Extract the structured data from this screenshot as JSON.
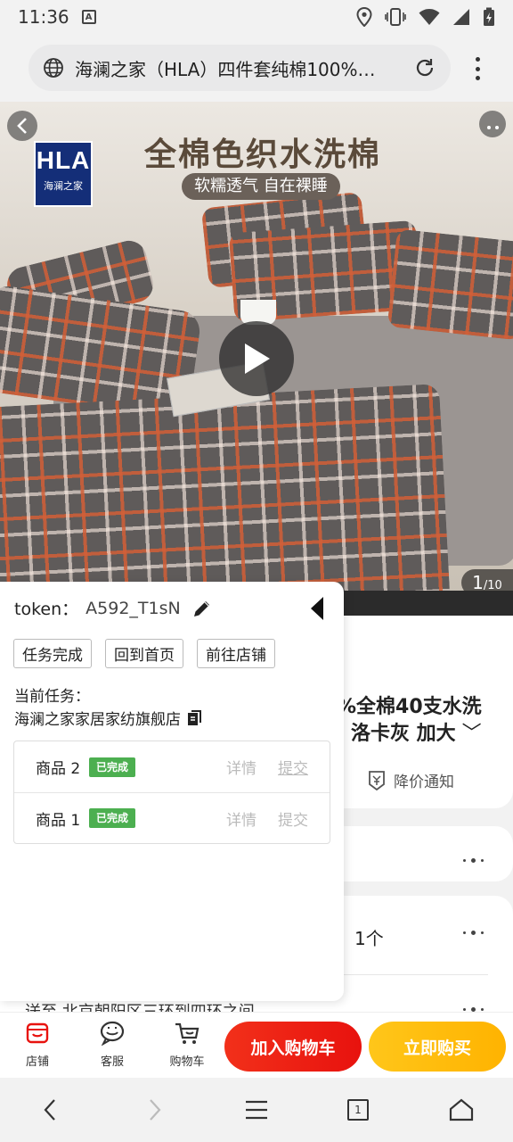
{
  "status_bar": {
    "time": "11:36"
  },
  "browser": {
    "url_text": "海澜之家（HLA）四件套纯棉100%…"
  },
  "hero": {
    "logo_line1": "HLA",
    "logo_line2": "海澜之家",
    "headline": "全棉色织水洗棉",
    "subheadline": "软糯透气 自在裸睡",
    "page_current": "1",
    "page_total": "/10"
  },
  "product": {
    "name_line1": "%全棉40支水洗",
    "name_line2": "洛卡灰 加大",
    "price_notice": "降价通知",
    "quantity": "1个",
    "shipping": "送至  北京朝阳区三环到四环之间"
  },
  "action_bar": {
    "shop": "店铺",
    "service": "客服",
    "cart": "购物车",
    "add_to_cart": "加入购物车",
    "buy_now": "立即购买"
  },
  "panel": {
    "token_label": "token：",
    "token_value": "A592_T1sN",
    "buttons": [
      "任务完成",
      "回到首页",
      "前往店铺"
    ],
    "current_task_label": "当前任务：",
    "current_task_value": "海澜之家家居家纺旗舰店",
    "tasks": [
      {
        "name": "商品 2",
        "status": "已完成",
        "detail": "详情",
        "submit": "提交"
      },
      {
        "name": "商品 1",
        "status": "已完成",
        "detail": "详情",
        "submit": "提交"
      }
    ]
  },
  "colors": {
    "add_to_cart": "#e8120e",
    "buy_now": "#ffb300",
    "badge_done": "#4caf50",
    "shop_icon": "#e8120e"
  },
  "sysnav": {
    "tab_count": "1"
  }
}
